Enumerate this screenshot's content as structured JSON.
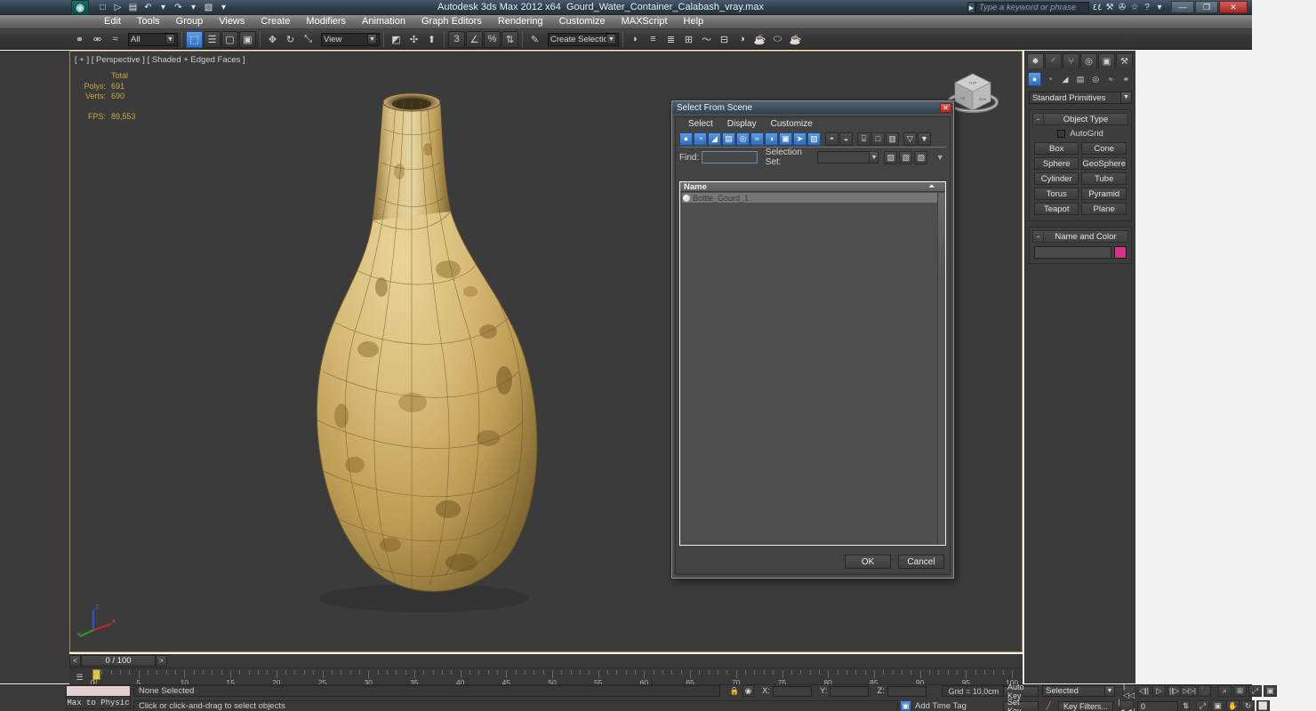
{
  "titlebar": {
    "app_title": "Autodesk 3ds Max  2012 x64",
    "file_title": "Gourd_Water_Container_Calabash_vray.max",
    "logo": "3ds-max-logo",
    "search_placeholder": "Type a keyword or phrase",
    "quick_access": [
      {
        "name": "new-file-icon",
        "glyph": "□"
      },
      {
        "name": "open-file-icon",
        "glyph": "▷"
      },
      {
        "name": "save-file-icon",
        "glyph": "▤"
      },
      {
        "name": "undo-icon",
        "glyph": "↶"
      },
      {
        "name": "undo-dropdown-icon",
        "glyph": "▾"
      },
      {
        "name": "redo-icon",
        "glyph": "↷"
      },
      {
        "name": "redo-dropdown-icon",
        "glyph": "▾"
      },
      {
        "name": "set-project-folder-icon",
        "glyph": "▧"
      },
      {
        "name": "quick-access-dropdown-icon",
        "glyph": "▾"
      }
    ],
    "help_icons": [
      {
        "name": "search-binoculars-icon",
        "glyph": "٤٤"
      },
      {
        "name": "wrench-icon",
        "glyph": "⚒"
      },
      {
        "name": "workspace-icon",
        "glyph": "✇"
      },
      {
        "name": "favorites-star-icon",
        "glyph": "☆"
      },
      {
        "name": "help-icon",
        "glyph": "?"
      },
      {
        "name": "help-dropdown-icon",
        "glyph": "▾"
      }
    ],
    "window_buttons": [
      {
        "name": "minimize-button",
        "glyph": "—"
      },
      {
        "name": "maximize-button",
        "glyph": "❐"
      },
      {
        "name": "close-button",
        "glyph": "✕"
      }
    ]
  },
  "menubar": {
    "items": [
      "Edit",
      "Tools",
      "Group",
      "Views",
      "Create",
      "Modifiers",
      "Animation",
      "Graph Editors",
      "Rendering",
      "Customize",
      "MAXScript",
      "Help"
    ]
  },
  "toolbar": {
    "selection_filter": "All",
    "selection_set": "Create Selection Se",
    "reference_coord": "View",
    "groups": [
      [
        {
          "name": "select-and-link-icon",
          "glyph": "⚭"
        },
        {
          "name": "unlink-selection-icon",
          "glyph": "⚮"
        },
        {
          "name": "bind-to-space-warp-icon",
          "glyph": "≈"
        }
      ],
      [
        {
          "name": "select-object-icon",
          "glyph": "⬚",
          "active": true
        },
        {
          "name": "select-by-name-icon",
          "glyph": "☰"
        },
        {
          "name": "rectangular-selection-region-icon",
          "glyph": "▢"
        },
        {
          "name": "window-crossing-toggle-icon",
          "glyph": "▣"
        }
      ],
      [
        {
          "name": "select-and-move-icon",
          "glyph": "✥"
        },
        {
          "name": "select-and-rotate-icon",
          "glyph": "↻"
        },
        {
          "name": "select-and-scale-icon",
          "glyph": "⤡"
        }
      ],
      [
        {
          "name": "use-pivot-point-center-icon",
          "glyph": "◩"
        },
        {
          "name": "select-and-manipulate-icon",
          "glyph": "✣"
        },
        {
          "name": "keyboard-shortcut-override-icon",
          "glyph": "⬆"
        }
      ],
      [
        {
          "name": "snaps-toggle-icon",
          "glyph": "3"
        },
        {
          "name": "angle-snap-toggle-icon",
          "glyph": "∠"
        },
        {
          "name": "percent-snap-toggle-icon",
          "glyph": "%"
        },
        {
          "name": "spinner-snap-toggle-icon",
          "glyph": "⇅"
        }
      ],
      [
        {
          "name": "edit-named-selection-sets-icon",
          "glyph": "✎"
        }
      ],
      [
        {
          "name": "mirror-icon",
          "glyph": "◗"
        },
        {
          "name": "align-icon",
          "glyph": "≡"
        },
        {
          "name": "layer-manager-icon",
          "glyph": "≣"
        },
        {
          "name": "toggle-scene-explorer-icon",
          "glyph": "⊞"
        },
        {
          "name": "curve-editor-icon",
          "glyph": "〜"
        },
        {
          "name": "schematic-view-icon",
          "glyph": "⊟"
        },
        {
          "name": "material-editor-icon",
          "glyph": "◑"
        },
        {
          "name": "render-setup-icon",
          "glyph": "☕"
        },
        {
          "name": "rendered-frame-window-icon",
          "glyph": "⬭"
        },
        {
          "name": "render-production-icon",
          "glyph": "☕"
        }
      ]
    ]
  },
  "viewport": {
    "label": "[ + ] [ Perspective ] [ Shaded + Edged Faces ]",
    "stats": {
      "total_header": "Total",
      "polys_label": "Polys:",
      "polys_value": "691",
      "verts_label": "Verts:",
      "verts_value": "690",
      "fps_label": "FPS:",
      "fps_value": "89,553"
    },
    "viewcube_faces": [
      "TOP",
      "FRONT",
      "RIGHT"
    ],
    "axis_labels": [
      "X",
      "Y",
      "Z"
    ],
    "background_color": "#3b3b3b",
    "border_color": "#9c8746"
  },
  "command_panel": {
    "tabs": [
      {
        "name": "tab-create",
        "glyph": "✹",
        "active": true
      },
      {
        "name": "tab-modify",
        "glyph": "◜"
      },
      {
        "name": "tab-hierarchy",
        "glyph": "⑂"
      },
      {
        "name": "tab-motion",
        "glyph": "◎"
      },
      {
        "name": "tab-display",
        "glyph": "▣"
      },
      {
        "name": "tab-utilities",
        "glyph": "⚒"
      }
    ],
    "primitive_types": [
      {
        "name": "geometry-icon",
        "glyph": "●",
        "active": true
      },
      {
        "name": "shapes-icon",
        "glyph": "◔"
      },
      {
        "name": "lights-icon",
        "glyph": "◢"
      },
      {
        "name": "cameras-icon",
        "glyph": "▤"
      },
      {
        "name": "helpers-icon",
        "glyph": "◎"
      },
      {
        "name": "space-warps-icon",
        "glyph": "≈"
      },
      {
        "name": "systems-icon",
        "glyph": "⚭"
      }
    ],
    "category": "Standard Primitives",
    "object_type": {
      "title": "Object Type",
      "autogrid_label": "AutoGrid",
      "buttons": [
        "Box",
        "Cone",
        "Sphere",
        "GeoSphere",
        "Cylinder",
        "Tube",
        "Torus",
        "Pyramid",
        "Teapot",
        "Plane"
      ]
    },
    "name_and_color": {
      "title": "Name and Color",
      "name_value": "",
      "color": "#d6348b"
    }
  },
  "dialog": {
    "title": "Select From Scene",
    "close_glyph": "✕",
    "menus": [
      "Select",
      "Display",
      "Customize"
    ],
    "toolbar_icons": [
      {
        "name": "display-geometry-icon",
        "glyph": "●",
        "on": true
      },
      {
        "name": "display-shapes-icon",
        "glyph": "◔",
        "on": true
      },
      {
        "name": "display-lights-icon",
        "glyph": "◢",
        "on": true
      },
      {
        "name": "display-cameras-icon",
        "glyph": "▤",
        "on": true
      },
      {
        "name": "display-helpers-icon",
        "glyph": "◎",
        "on": true
      },
      {
        "name": "display-space-warps-icon",
        "glyph": "≈",
        "on": true
      },
      {
        "name": "display-groups-icon",
        "glyph": "◑",
        "on": true
      },
      {
        "name": "display-xrefs-icon",
        "glyph": "▣",
        "on": true
      },
      {
        "name": "display-bones-icon",
        "glyph": "➤",
        "on": true
      },
      {
        "name": "display-containers-icon",
        "glyph": "▨",
        "on": true
      },
      {
        "name": "display-influences-icon",
        "glyph": "◓"
      },
      {
        "name": "display-frozen-icon",
        "glyph": "◒"
      },
      {
        "name": "expand-all-icon",
        "glyph": "⌸"
      },
      {
        "name": "collapse-all-icon",
        "glyph": "□"
      },
      {
        "name": "select-children-icon",
        "glyph": "▥"
      },
      {
        "name": "filter-icon",
        "glyph": "▽"
      },
      {
        "name": "advanced-filter-icon",
        "glyph": "▼"
      }
    ],
    "find_label": "Find:",
    "find_value": "",
    "selection_set_label": "Selection Set:",
    "selection_set_value": "",
    "set_icons": [
      {
        "name": "add-selection-set-icon",
        "glyph": "▧"
      },
      {
        "name": "remove-selection-set-icon",
        "glyph": "▧"
      },
      {
        "name": "edit-selection-set-icon",
        "glyph": "▧"
      }
    ],
    "list_header": "Name",
    "sort_glyph": "⏶",
    "items": [
      {
        "name": "Bottle_Gourd_1",
        "icon": "geometry-sphere-icon"
      }
    ],
    "ok_label": "OK",
    "cancel_label": "Cancel"
  },
  "timeslider": {
    "prev_frame": "<",
    "next_frame": ">",
    "current": "0 / 100"
  },
  "trackbar": {
    "ticks": [
      0,
      5,
      10,
      15,
      20,
      25,
      30,
      35,
      40,
      45,
      50,
      55,
      60,
      65,
      70,
      75,
      80,
      85,
      90,
      95,
      100
    ],
    "playhead_label": "0",
    "open_mini_curve_editor_icon": "curve-editor-icon"
  },
  "statusbar": {
    "physique_label": "Max to Physic",
    "selection_status": "None Selected",
    "prompt": "Click or click-and-drag to select objects",
    "lock_icon": "lock-selection-icon",
    "absolute_mode_icon": "absolute-relative-transform-icon",
    "coords": [
      {
        "label": "X:",
        "value": ""
      },
      {
        "label": "Y:",
        "value": ""
      },
      {
        "label": "Z:",
        "value": ""
      }
    ],
    "grid": "Grid = 10,0cm",
    "add_time_tag": "Add Time Tag",
    "auto_key": "Auto Key",
    "set_key": "Set Key",
    "key_mode": "Selected",
    "key_filters": "Key Filters...",
    "frame_field": "0",
    "playback_icons": [
      {
        "name": "go-to-start-icon",
        "glyph": "|◁◁"
      },
      {
        "name": "previous-frame-icon",
        "glyph": "◁||"
      },
      {
        "name": "play-animation-icon",
        "glyph": "▷"
      },
      {
        "name": "next-frame-icon",
        "glyph": "||▷"
      },
      {
        "name": "go-to-end-icon",
        "glyph": "▷▷|"
      },
      {
        "name": "key-mode-toggle-icon",
        "glyph": "⚫"
      }
    ],
    "nav_icons": [
      {
        "name": "zoom-icon",
        "glyph": "⌕"
      },
      {
        "name": "zoom-all-icon",
        "glyph": "⊞"
      },
      {
        "name": "zoom-extents-icon",
        "glyph": "⤢"
      },
      {
        "name": "zoom-region-icon",
        "glyph": "▣"
      },
      {
        "name": "pan-view-icon",
        "glyph": "✋"
      },
      {
        "name": "orbit-icon",
        "glyph": "↻"
      },
      {
        "name": "maximize-viewport-toggle-icon",
        "glyph": "⬜"
      }
    ]
  }
}
